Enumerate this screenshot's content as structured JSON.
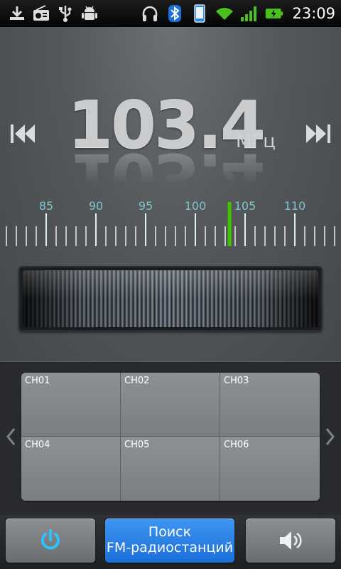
{
  "status_bar": {
    "time": "23:09",
    "left_icons": [
      "download-icon",
      "radio-icon",
      "usb-icon",
      "android-debug-icon"
    ],
    "right_icons": [
      "headphones-icon",
      "bluetooth-icon",
      "phone-sync-icon",
      "wifi-icon",
      "signal-icon",
      "battery-charging-icon"
    ]
  },
  "tuner": {
    "frequency": "103.4",
    "unit": "МГц",
    "scale_labels": [
      "85",
      "90",
      "95",
      "100",
      "105",
      "110"
    ],
    "scale_min": 81,
    "scale_max": 114,
    "current_frequency_value": 103.4
  },
  "channels": [
    {
      "label": "CH01"
    },
    {
      "label": "CH02"
    },
    {
      "label": "CH03"
    },
    {
      "label": "CH04"
    },
    {
      "label": "CH05"
    },
    {
      "label": "CH06"
    }
  ],
  "bottom_bar": {
    "search_line1": "Поиск",
    "search_line2": "FM-радиостанций"
  },
  "colors": {
    "accent_blue": "#2a84eb",
    "tuner_needle": "#3fc400",
    "scale_label": "#7fc4cc",
    "power_icon": "#2ec3ff"
  }
}
